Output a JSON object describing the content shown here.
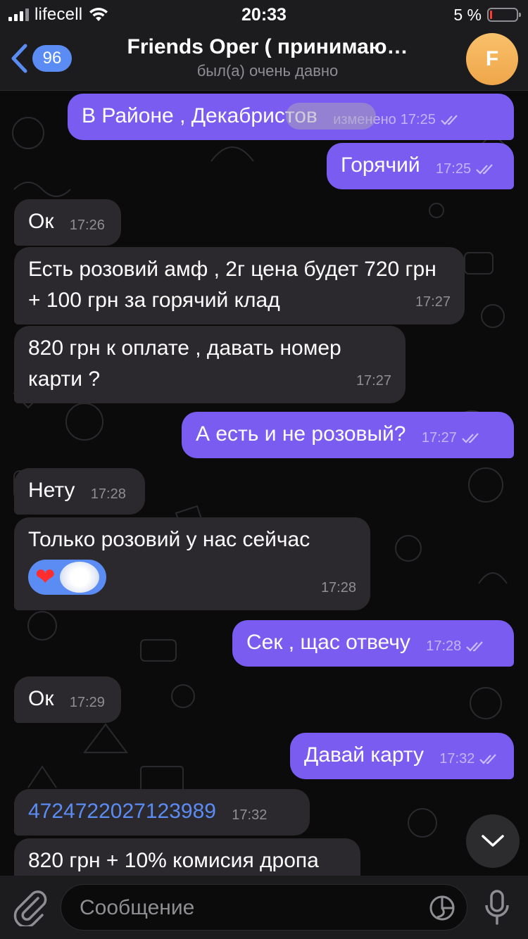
{
  "status_bar": {
    "carrier": "lifecell",
    "time": "20:33",
    "battery_percent": "5 %",
    "battery_level": 0.05
  },
  "header": {
    "back_count": "96",
    "title": "Friends Oper ( принимаю…",
    "subtitle": "был(а) очень давно",
    "avatar_letter": "F"
  },
  "messages": [
    {
      "direction": "out",
      "text": "В Районе , Декабристов",
      "meta_note": "изменено",
      "time": "17:25",
      "read": true
    },
    {
      "direction": "out",
      "text": "Горячий",
      "time": "17:25",
      "read": true
    },
    {
      "direction": "in",
      "text": "Ок",
      "time": "17:26"
    },
    {
      "direction": "in",
      "text": "Есть розовий амф , 2г цена будет 720 грн + 100 грн за горячий клад",
      "time": "17:27"
    },
    {
      "direction": "in",
      "text": "820 грн к оплате , давать номер карти ?",
      "time": "17:27"
    },
    {
      "direction": "out",
      "text": "А есть и не розовый?",
      "time": "17:27",
      "read": true
    },
    {
      "direction": "in",
      "text": "Нету",
      "time": "17:28"
    },
    {
      "direction": "in",
      "text": "Только розовий у нас сейчас",
      "time": "17:28",
      "reaction": "❤️"
    },
    {
      "direction": "out",
      "text": "Сек , щас отвечу",
      "time": "17:28",
      "read": true
    },
    {
      "direction": "in",
      "text": "Ок",
      "time": "17:29"
    },
    {
      "direction": "out",
      "text": "Давай карту",
      "time": "17:32",
      "read": true
    },
    {
      "direction": "in",
      "text": "4724722027123989",
      "time": "17:32",
      "is_link": true
    },
    {
      "direction": "in",
      "text": "820 грн + 10% комисия дропа"
    }
  ],
  "input": {
    "placeholder": "Сообщение"
  },
  "icons": {
    "back": "chevron-left-icon",
    "scroll_down": "chevron-down-icon",
    "attach": "paperclip-icon",
    "sticker": "sticker-icon",
    "mic": "microphone-icon",
    "read": "double-check-icon"
  },
  "colors": {
    "outgoing_bubble": "#7b5cf0",
    "incoming_bubble": "#2b292e",
    "accent": "#5b8cf3",
    "background": "#0b0b0c"
  }
}
